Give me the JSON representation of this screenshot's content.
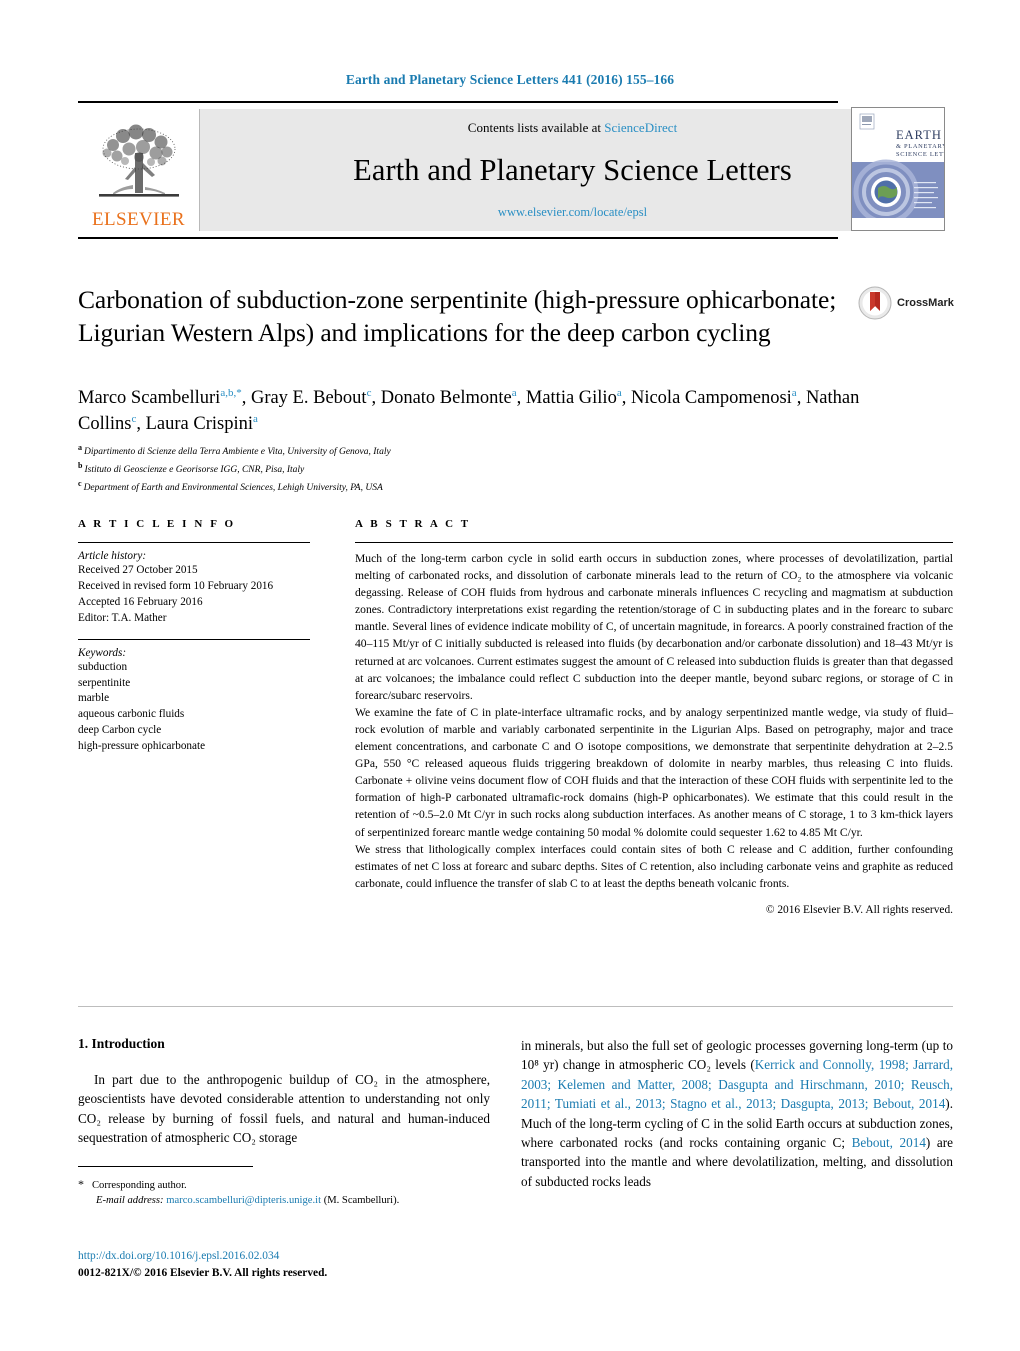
{
  "running_head": "Earth and Planetary Science Letters 441 (2016) 155–166",
  "masthead": {
    "contents_prefix": "Contents lists available at ",
    "sciencedirect": "ScienceDirect",
    "journal_name": "Earth and Planetary Science Letters",
    "journal_url": "www.elsevier.com/locate/epsl",
    "publisher": "ELSEVIER",
    "cover_title_line1": "EARTH",
    "cover_title_line2": "& PLANETARY",
    "cover_title_line3": "SCIENCE LETTERS"
  },
  "crossmark": {
    "label": "CrossMark"
  },
  "title": "Carbonation of subduction-zone serpentinite (high-pressure ophicarbonate; Ligurian Western Alps) and implications for the deep carbon cycling",
  "authors": [
    {
      "name": "Marco Scambelluri",
      "marks": "a,b,",
      "star": true
    },
    {
      "name": "Gray E. Bebout",
      "marks": "c",
      "star": false
    },
    {
      "name": "Donato Belmonte",
      "marks": "a",
      "star": false
    },
    {
      "name": "Mattia Gilio",
      "marks": "a",
      "star": false
    },
    {
      "name": "Nicola Campomenosi",
      "marks": "a",
      "star": false
    },
    {
      "name": "Nathan Collins",
      "marks": "c",
      "star": false
    },
    {
      "name": "Laura Crispini",
      "marks": "a",
      "star": false
    }
  ],
  "affiliations": [
    {
      "label": "a",
      "text": "Dipartimento di Scienze della Terra Ambiente e Vita, University of Genova, Italy"
    },
    {
      "label": "b",
      "text": "Istituto di Geoscienze e Georisorse IGG, CNR, Pisa, Italy"
    },
    {
      "label": "c",
      "text": "Department of Earth and Environmental Sciences, Lehigh University, PA, USA"
    }
  ],
  "article_info": {
    "heading": "A R T I C L E   I N F O",
    "history_title": "Article history:",
    "history": [
      "Received 27 October 2015",
      "Received in revised form 10 February 2016",
      "Accepted 16 February 2016",
      "Editor: T.A. Mather"
    ],
    "keywords_title": "Keywords:",
    "keywords": [
      "subduction",
      "serpentinite",
      "marble",
      "aqueous carbonic fluids",
      "deep Carbon cycle",
      "high-pressure ophicarbonate"
    ]
  },
  "abstract": {
    "heading": "A B S T R A C T",
    "paragraphs": [
      "Much of the long-term carbon cycle in solid earth occurs in subduction zones, where processes of devolatilization, partial melting of carbonated rocks, and dissolution of carbonate minerals lead to the return of CO₂ to the atmosphere via volcanic degassing. Release of COH fluids from hydrous and carbonate minerals influences C recycling and magmatism at subduction zones. Contradictory interpretations exist regarding the retention/storage of C in subducting plates and in the forearc to subarc mantle. Several lines of evidence indicate mobility of C, of uncertain magnitude, in forearcs. A poorly constrained fraction of the 40–115 Mt/yr of C initially subducted is released into fluids (by decarbonation and/or carbonate dissolution) and 18–43 Mt/yr is returned at arc volcanoes. Current estimates suggest the amount of C released into subduction fluids is greater than that degassed at arc volcanoes; the imbalance could reflect C subduction into the deeper mantle, beyond subarc regions, or storage of C in forearc/subarc reservoirs.",
      "We examine the fate of C in plate-interface ultramafic rocks, and by analogy serpentinized mantle wedge, via study of fluid–rock evolution of marble and variably carbonated serpentinite in the Ligurian Alps. Based on petrography, major and trace element concentrations, and carbonate C and O isotope compositions, we demonstrate that serpentinite dehydration at 2–2.5 GPa, 550 °C released aqueous fluids triggering breakdown of dolomite in nearby marbles, thus releasing C into fluids. Carbonate + olivine veins document flow of COH fluids and that the interaction of these COH fluids with serpentinite led to the formation of high-P carbonated ultramafic-rock domains (high-P ophicarbonates). We estimate that this could result in the retention of ~0.5–2.0 Mt C/yr in such rocks along subduction interfaces. As another means of C storage, 1 to 3 km-thick layers of serpentinized forearc mantle wedge containing 50 modal % dolomite could sequester 1.62 to 4.85 Mt C/yr.",
      "We stress that lithologically complex interfaces could contain sites of both C release and C addition, further confounding estimates of net C loss at forearc and subarc depths. Sites of C retention, also including carbonate veins and graphite as reduced carbonate, could influence the transfer of slab C to at least the depths beneath volcanic fronts."
    ],
    "copyright": "© 2016 Elsevier B.V. All rights reserved."
  },
  "body": {
    "section_number_title": "1. Introduction",
    "left_paragraph_parts": [
      "In part due to the anthropogenic buildup of CO₂ in the atmosphere, geoscientists have devoted considerable attention to understanding not only CO₂ release by burning of fossil fuels, and natural and human-induced sequestration of atmospheric CO₂ storage"
    ],
    "right_paragraph_lead": "in minerals, but also the full set of geologic processes governing long-term (up to 10⁸ yr) change in atmospheric CO₂ levels (",
    "right_citation_1": "Kerrick and Connolly, 1998; Jarrard, 2003; Kelemen and Matter, 2008; Dasgupta and Hirschmann, 2010; Reusch, 2011; Tumiati et al., 2013; Stagno et al., 2013; Dasgupta, 2013; Bebout, 2014",
    "right_paragraph_mid": "). Much of the long-term cycling of C in the solid Earth occurs at subduction zones, where carbonated rocks (and rocks containing organic C; ",
    "right_citation_2": "Bebout, 2014",
    "right_paragraph_tail": ") are transported into the mantle and where devolatilization, melting, and dissolution of subducted rocks leads"
  },
  "footnotes": {
    "corresponding_marker": "*",
    "corresponding_text": "Corresponding author.",
    "email_label": "E-mail address:",
    "email": "marco.scambelluri@dipteris.unige.it",
    "email_owner": "(M. Scambelluri)."
  },
  "doi": {
    "url": "http://dx.doi.org/10.1016/j.epsl.2016.02.034",
    "issn_line": "0012-821X/© 2016 Elsevier B.V. All rights reserved."
  },
  "colors": {
    "link_blue": "#1a7bb0",
    "sciencedirect_blue": "#2a8fc4",
    "elsevier_orange": "#E9711C",
    "band_gray": "#e8e8e8",
    "crossmark_red": "#c0392b"
  }
}
